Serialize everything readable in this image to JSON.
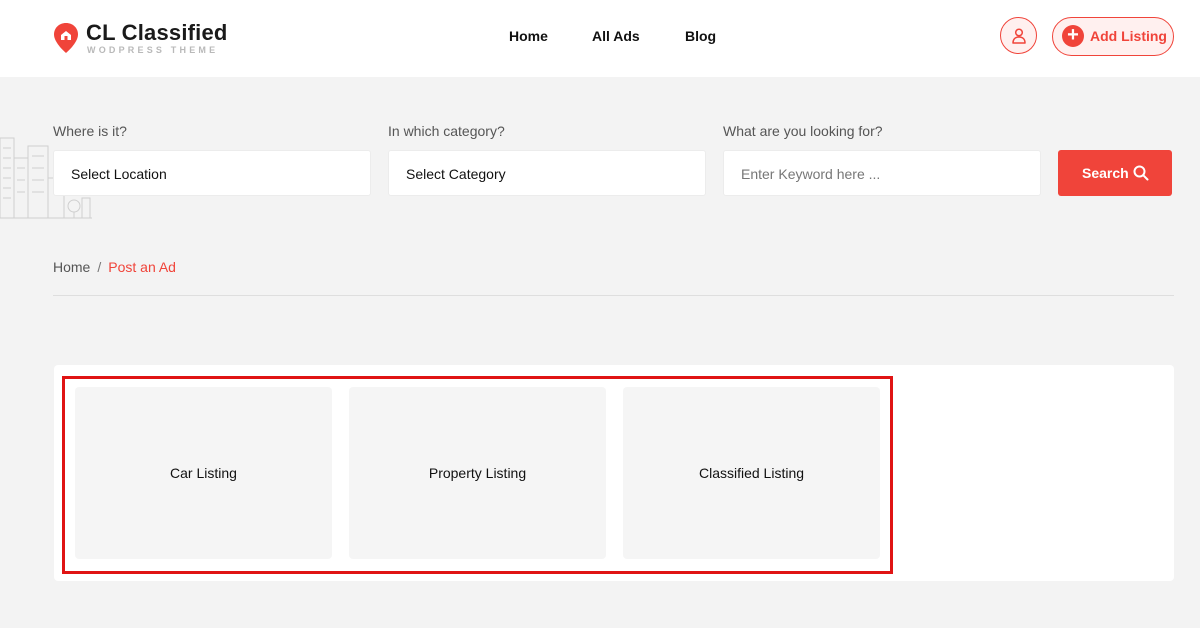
{
  "brand": {
    "name": "CL Classified",
    "tagline": "WODPRESS THEME",
    "accent": "#f0443a"
  },
  "nav": {
    "items": [
      {
        "label": "Home"
      },
      {
        "label": "All Ads"
      },
      {
        "label": "Blog"
      }
    ]
  },
  "header_actions": {
    "user_icon": "user-icon",
    "add_listing_label": "Add Listing",
    "add_icon": "plus-icon"
  },
  "search": {
    "location": {
      "label": "Where is it?",
      "value": "Select Location"
    },
    "category": {
      "label": "In which category?",
      "value": "Select Category"
    },
    "keyword": {
      "label": "What are you looking for?",
      "placeholder": "Enter Keyword here ..."
    },
    "button_label": "Search",
    "button_icon": "search-icon"
  },
  "breadcrumb": {
    "home": "Home",
    "separator": "/",
    "current": "Post an Ad"
  },
  "listing_types": {
    "highlight_color": "#e01414",
    "items": [
      {
        "label": "Car Listing"
      },
      {
        "label": "Property Listing"
      },
      {
        "label": "Classified Listing"
      }
    ]
  }
}
